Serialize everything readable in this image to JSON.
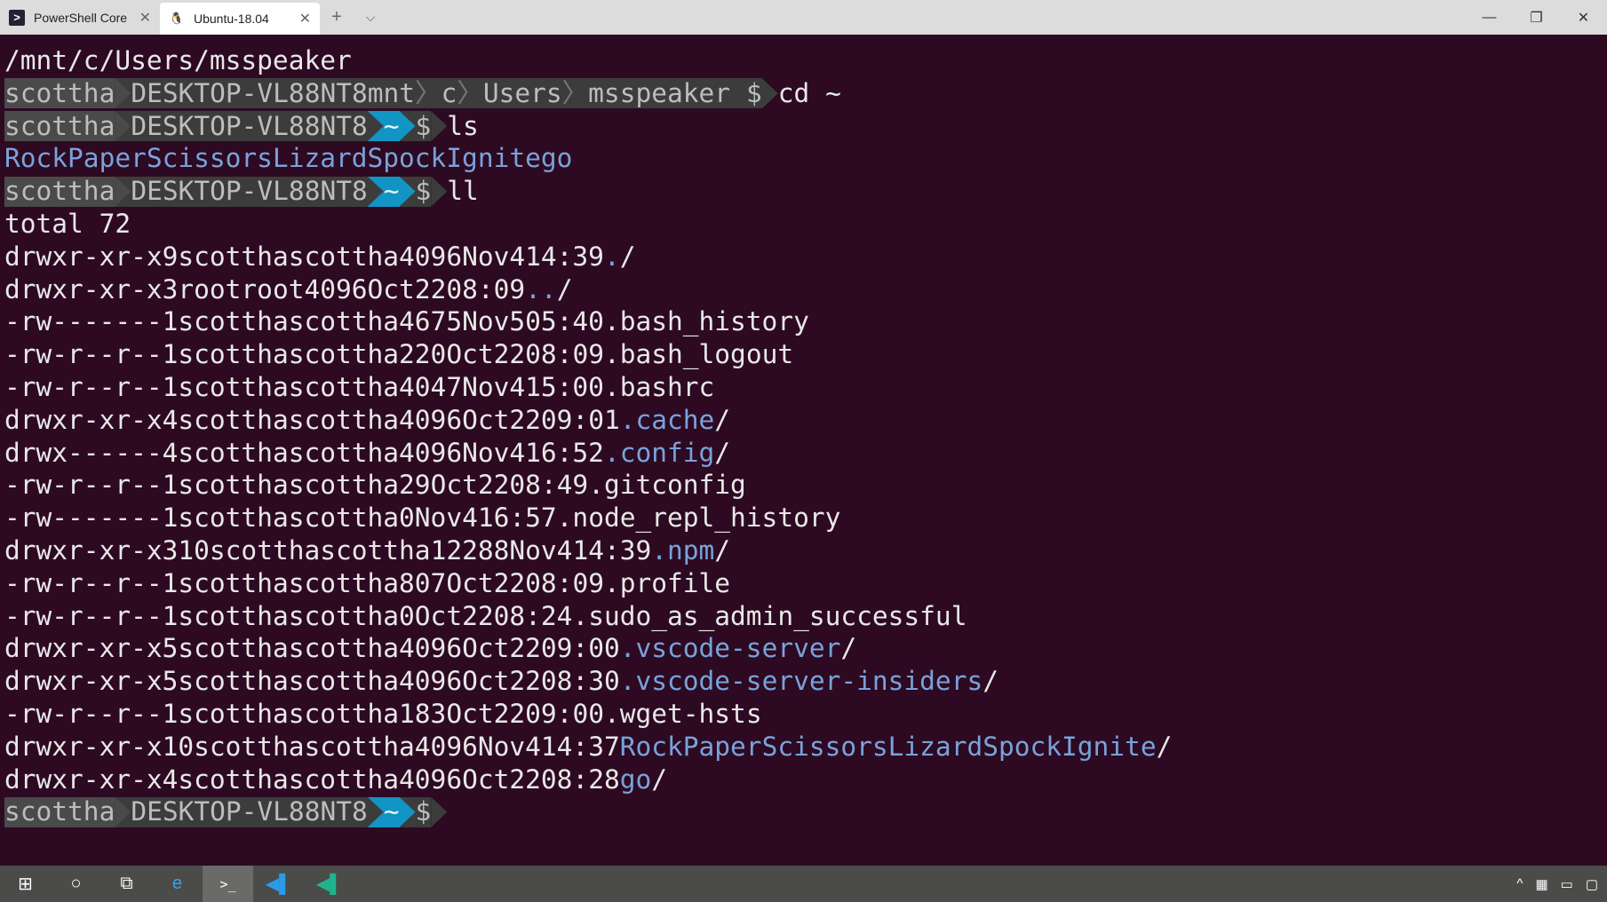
{
  "tabs": [
    {
      "label": "PowerShell Core",
      "icon": "powershell-icon"
    },
    {
      "label": "Ubuntu-18.04",
      "icon": "linux-tux-icon"
    }
  ],
  "tab_controls": {
    "new_tab": "+",
    "dropdown": "⌵",
    "close": "✕"
  },
  "window_controls": {
    "minimize": "—",
    "restore": "❐",
    "close": "✕"
  },
  "terminal": {
    "cwd_line": "/mnt/c/Users/msspeaker",
    "user": "scottha",
    "host": "DESKTOP-VL88NT8",
    "path1": [
      "mnt",
      "c",
      "Users",
      "msspeaker"
    ],
    "home": "~",
    "dollar": "$",
    "commands": [
      "cd ~",
      "ls",
      "ll"
    ],
    "ls_output": [
      "RockPaperScissorsLizardSpockIgnite",
      "go"
    ],
    "total": "total 72",
    "listing": [
      [
        "drwxr-xr-x",
        "9",
        "scottha",
        "scottha",
        "4096",
        "Nov",
        "4",
        "14:39",
        ".",
        "/"
      ],
      [
        "drwxr-xr-x",
        "3",
        "root",
        "root",
        "4096",
        "Oct",
        "22",
        "08:09",
        "..",
        "/"
      ],
      [
        "-rw-------",
        "1",
        "scottha",
        "scottha",
        "4675",
        "Nov",
        "5",
        "05:40",
        ".bash_history",
        ""
      ],
      [
        "-rw-r--r--",
        "1",
        "scottha",
        "scottha",
        "220",
        "Oct",
        "22",
        "08:09",
        ".bash_logout",
        ""
      ],
      [
        "-rw-r--r--",
        "1",
        "scottha",
        "scottha",
        "4047",
        "Nov",
        "4",
        "15:00",
        ".bashrc",
        ""
      ],
      [
        "drwxr-xr-x",
        "4",
        "scottha",
        "scottha",
        "4096",
        "Oct",
        "22",
        "09:01",
        ".cache",
        "/"
      ],
      [
        "drwx------",
        "4",
        "scottha",
        "scottha",
        "4096",
        "Nov",
        "4",
        "16:52",
        ".config",
        "/"
      ],
      [
        "-rw-r--r--",
        "1",
        "scottha",
        "scottha",
        "29",
        "Oct",
        "22",
        "08:49",
        ".gitconfig",
        ""
      ],
      [
        "-rw-------",
        "1",
        "scottha",
        "scottha",
        "0",
        "Nov",
        "4",
        "16:57",
        ".node_repl_history",
        ""
      ],
      [
        "drwxr-xr-x",
        "310",
        "scottha",
        "scottha",
        "12288",
        "Nov",
        "4",
        "14:39",
        ".npm",
        "/"
      ],
      [
        "-rw-r--r--",
        "1",
        "scottha",
        "scottha",
        "807",
        "Oct",
        "22",
        "08:09",
        ".profile",
        ""
      ],
      [
        "-rw-r--r--",
        "1",
        "scottha",
        "scottha",
        "0",
        "Oct",
        "22",
        "08:24",
        ".sudo_as_admin_successful",
        ""
      ],
      [
        "drwxr-xr-x",
        "5",
        "scottha",
        "scottha",
        "4096",
        "Oct",
        "22",
        "09:00",
        ".vscode-server",
        "/"
      ],
      [
        "drwxr-xr-x",
        "5",
        "scottha",
        "scottha",
        "4096",
        "Oct",
        "22",
        "08:30",
        ".vscode-server-insiders",
        "/"
      ],
      [
        "-rw-r--r--",
        "1",
        "scottha",
        "scottha",
        "183",
        "Oct",
        "22",
        "09:00",
        ".wget-hsts",
        ""
      ],
      [
        "drwxr-xr-x",
        "10",
        "scottha",
        "scottha",
        "4096",
        "Nov",
        "4",
        "14:37",
        "RockPaperScissorsLizardSpockIgnite",
        "/"
      ],
      [
        "drwxr-xr-x",
        "4",
        "scottha",
        "scottha",
        "4096",
        "Oct",
        "22",
        "08:28",
        "go",
        "/"
      ]
    ]
  },
  "taskbar": [
    "start-icon",
    "search-icon",
    "task-view-icon",
    "edge-insider-icon",
    "terminal-icon",
    "vscode-icon",
    "vscode-insiders-icon"
  ],
  "colors": {
    "bg": "#2d0a22",
    "segment": "#3c3c3c",
    "accent": "#1294c4",
    "dir": "#7aa2da"
  }
}
